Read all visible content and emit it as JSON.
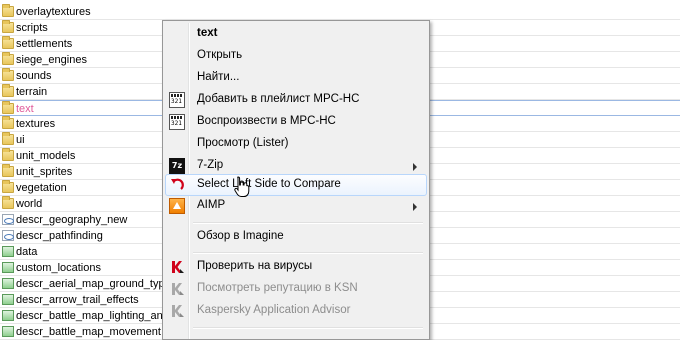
{
  "file_list": {
    "rows": [
      {
        "name": "overlaytextures",
        "type": "folder"
      },
      {
        "name": "scripts",
        "type": "folder"
      },
      {
        "name": "settlements",
        "type": "folder"
      },
      {
        "name": "siege_engines",
        "type": "folder"
      },
      {
        "name": "sounds",
        "type": "folder"
      },
      {
        "name": "terrain",
        "type": "folder"
      },
      {
        "name": "text",
        "type": "folder",
        "selected": true
      },
      {
        "name": "textures",
        "type": "folder"
      },
      {
        "name": "ui",
        "type": "folder"
      },
      {
        "name": "unit_models",
        "type": "folder"
      },
      {
        "name": "unit_sprites",
        "type": "folder"
      },
      {
        "name": "vegetation",
        "type": "folder"
      },
      {
        "name": "world",
        "type": "folder"
      },
      {
        "name": "descr_geography_new",
        "type": "file"
      },
      {
        "name": "descr_pathfinding",
        "type": "file"
      },
      {
        "name": "data",
        "type": "exe"
      },
      {
        "name": "custom_locations",
        "type": "exe"
      },
      {
        "name": "descr_aerial_map_ground_typ",
        "type": "exe"
      },
      {
        "name": "descr_arrow_trail_effects",
        "type": "exe"
      },
      {
        "name": "descr_battle_map_lighting_and",
        "type": "exe"
      },
      {
        "name": "descr_battle_map_movement",
        "type": "exe"
      }
    ]
  },
  "context_menu": {
    "items": [
      {
        "label": "text",
        "bold": true
      },
      {
        "label": "Открыть"
      },
      {
        "label": "Найти..."
      },
      {
        "label": "Добавить в плейлист MPC-HC",
        "icon": "mpc-hc-icon"
      },
      {
        "label": "Воспроизвести в MPC-HC",
        "icon": "mpc-hc-icon"
      },
      {
        "label": "Просмотр (Lister)"
      },
      {
        "label": "7-Zip",
        "icon": "7zip-icon",
        "submenu": true,
        "icon_text": "7z"
      },
      {
        "label": "Select Left Side to Compare",
        "icon": "compare-arrow-icon",
        "hovered": true
      },
      {
        "label": "AIMP",
        "icon": "aimp-icon",
        "submenu": true
      },
      {
        "label": "Обзор в Imagine"
      },
      {
        "label": "Проверить на вирусы",
        "icon": "kaspersky-icon"
      },
      {
        "label": "Посмотреть репутацию в KSN",
        "icon": "kaspersky-icon",
        "disabled": true
      },
      {
        "label": "Kaspersky Application Advisor",
        "icon": "kaspersky-icon",
        "disabled": true
      }
    ]
  },
  "colors": {
    "selected_text": "#e05a9a",
    "menu_background": "#f0f0f0",
    "hover_border": "#b8d6fb",
    "kaspersky_red": "#d0021b",
    "disabled_text": "#8d8d8d"
  }
}
